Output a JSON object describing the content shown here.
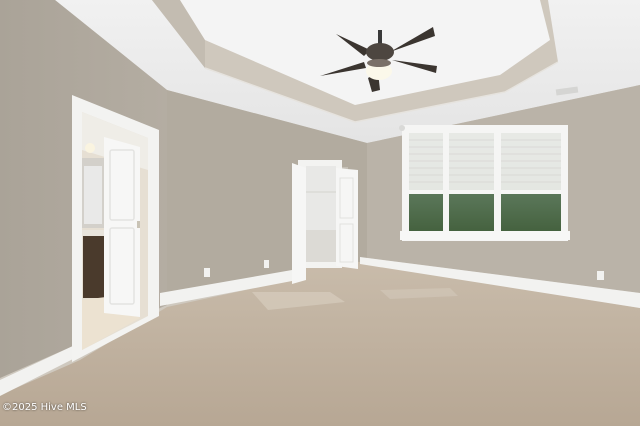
{
  "watermark": {
    "text": "©2025 Hive MLS"
  }
}
